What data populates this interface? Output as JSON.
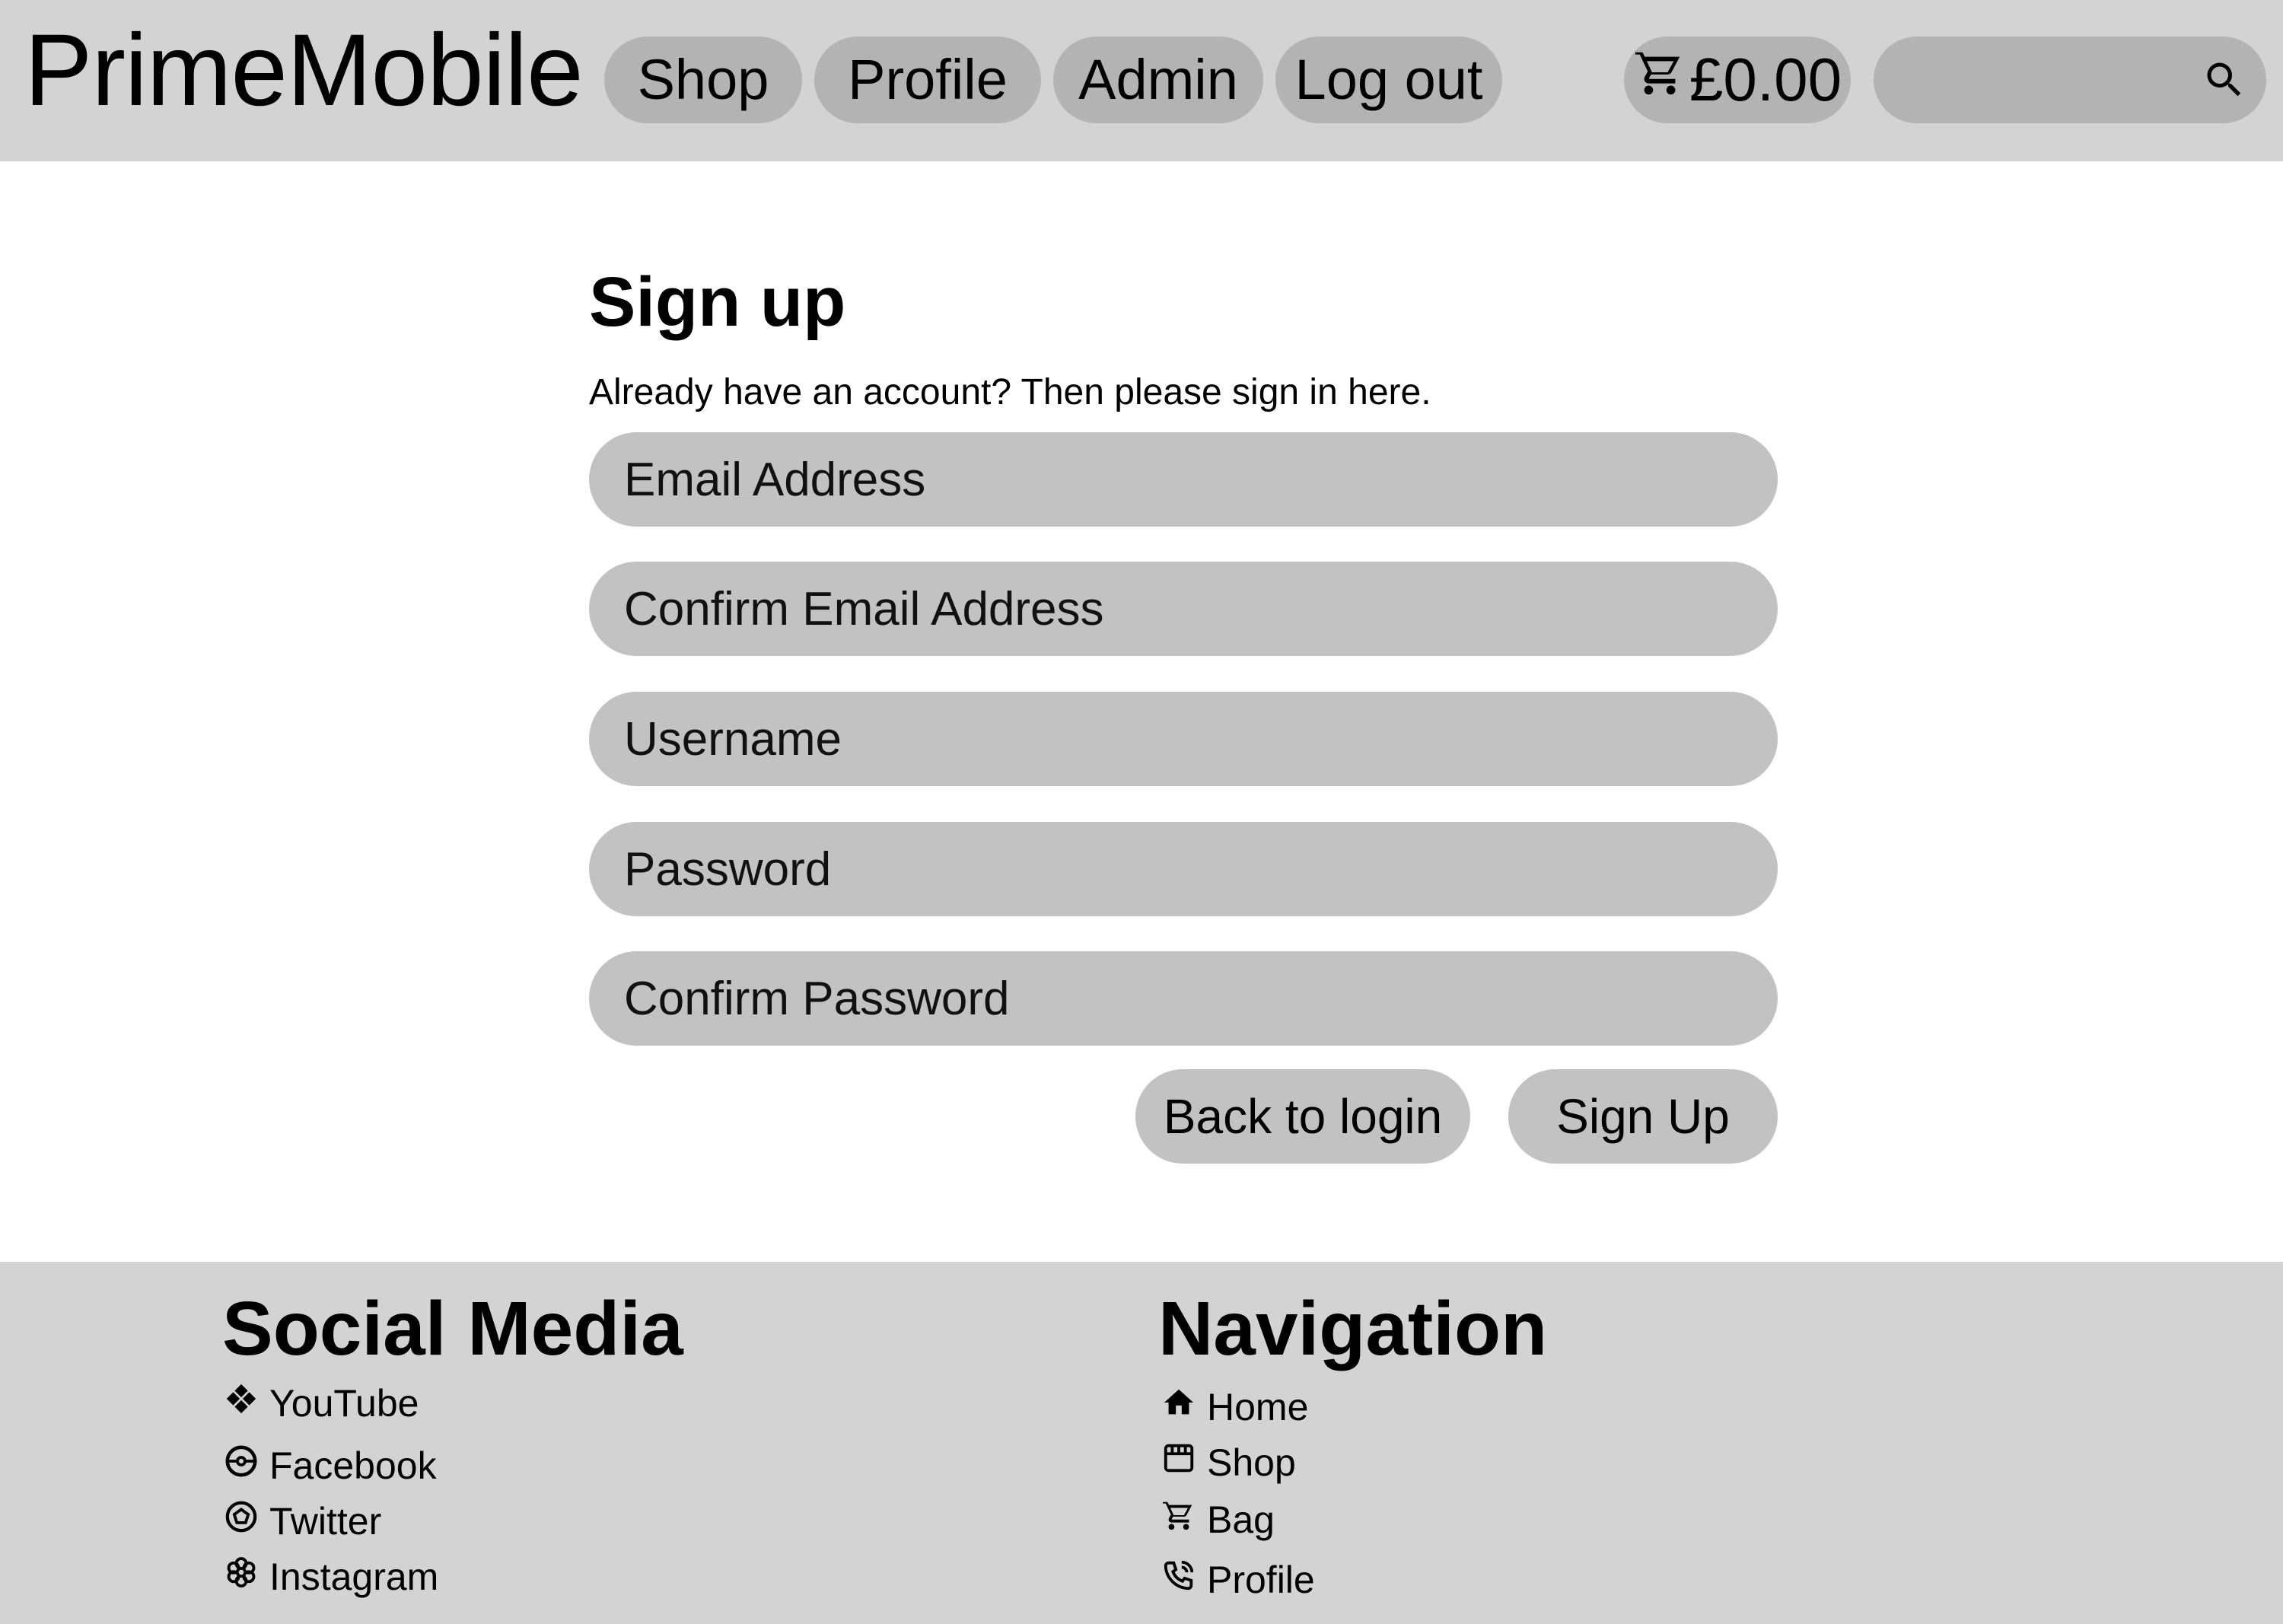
{
  "header": {
    "brand": "PrimeMobile",
    "nav": {
      "shop": "Shop",
      "profile": "Profile",
      "admin": "Admin",
      "logout": "Log out"
    },
    "cart_total": "£0.00",
    "cart_icon": "cart-icon",
    "search": {
      "value": "",
      "placeholder": "",
      "icon": "search-icon"
    }
  },
  "form": {
    "title": "Sign up",
    "subtitle": "Already have an account? Then please sign in here.",
    "fields": {
      "email": "Email Address",
      "confirm_email": "Confirm Email Address",
      "username": "Username",
      "password": "Password",
      "confirm_password": "Confirm Password"
    },
    "buttons": {
      "back": "Back to login",
      "signup": "Sign Up"
    }
  },
  "footer": {
    "social": {
      "heading": "Social Media",
      "links": [
        {
          "label": "YouTube",
          "icon": "youtube-icon"
        },
        {
          "label": "Facebook",
          "icon": "facebook-icon"
        },
        {
          "label": "Twitter",
          "icon": "twitter-icon"
        },
        {
          "label": "Instagram",
          "icon": "instagram-icon"
        }
      ]
    },
    "navigation": {
      "heading": "Navigation",
      "links": [
        {
          "label": "Home",
          "icon": "home-icon"
        },
        {
          "label": "Shop",
          "icon": "store-icon"
        },
        {
          "label": "Bag",
          "icon": "cart-icon"
        },
        {
          "label": "Profile",
          "icon": "phone-icon"
        }
      ]
    }
  },
  "colors": {
    "header_bg": "#d3d3d3",
    "pill_bg": "#b3b3b3",
    "field_bg": "#c2c2c2",
    "footer_bg": "#d3d3d3",
    "page_bg": "#ffffff"
  }
}
